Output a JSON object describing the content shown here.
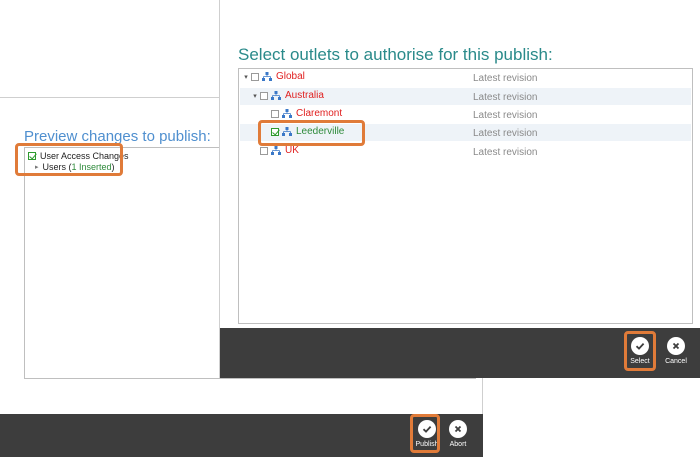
{
  "preview_dialog": {
    "title": "Preview changes to publish:",
    "tree": {
      "root_label": "User Access Changes",
      "child_prefix": "Users (",
      "child_count_text": "1 Inserted",
      "child_suffix": ")"
    },
    "footer": {
      "publish_label": "Publish",
      "abort_label": "Abort"
    }
  },
  "select_dialog": {
    "title": "Select outlets to authorise for this publish:",
    "outlets": [
      {
        "name": "Global",
        "revision": "Latest revision",
        "checked": false
      },
      {
        "name": "Australia",
        "revision": "Latest revision",
        "checked": false
      },
      {
        "name": "Claremont",
        "revision": "Latest revision",
        "checked": false
      },
      {
        "name": "Leederville",
        "revision": "Latest revision",
        "checked": true
      },
      {
        "name": "UK",
        "revision": "Latest revision",
        "checked": false
      }
    ],
    "footer": {
      "select_label": "Select",
      "cancel_label": "Cancel"
    }
  },
  "colors": {
    "highlight": "#e07b39",
    "footer_bg": "#3d3d3d",
    "unchecked_outlet": "#e02020",
    "checked_outlet": "#2e8a3a",
    "preview_title": "#4f8fcf",
    "select_title": "#2a8a8a"
  },
  "icons": {
    "outlet": "org-chart-icon",
    "publish": "checkmark-icon",
    "abort": "close-icon",
    "select": "checkmark-icon",
    "cancel": "close-icon",
    "expand": "triangle-down-icon"
  }
}
